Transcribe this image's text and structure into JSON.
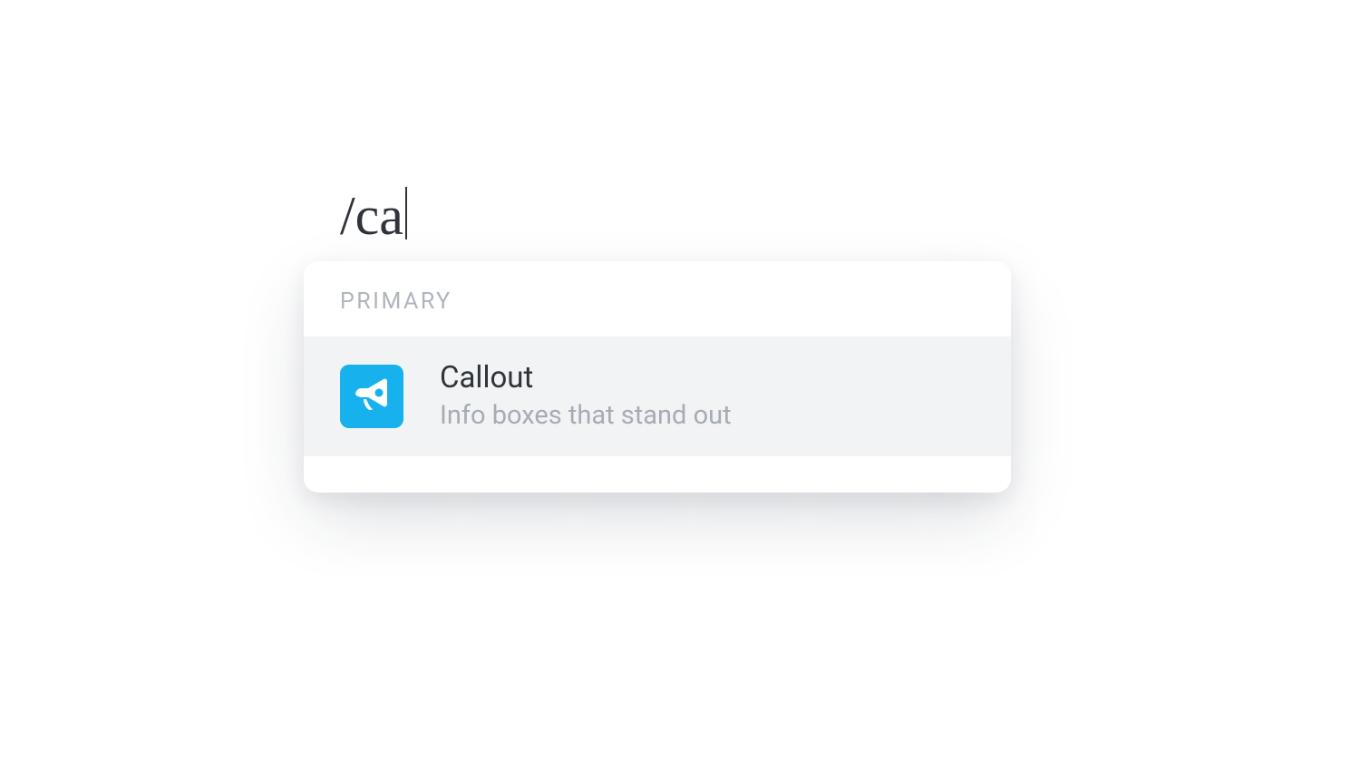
{
  "command": {
    "typed": "/ca"
  },
  "dropdown": {
    "section_label": "PRIMARY",
    "items": [
      {
        "icon": "megaphone-icon",
        "title": "Callout",
        "description": "Info boxes that stand out"
      }
    ]
  },
  "colors": {
    "accent": "#17b1ee",
    "text_primary": "#2f333a",
    "text_muted": "#a6acb4",
    "item_highlight_bg": "#f1f3f5"
  }
}
